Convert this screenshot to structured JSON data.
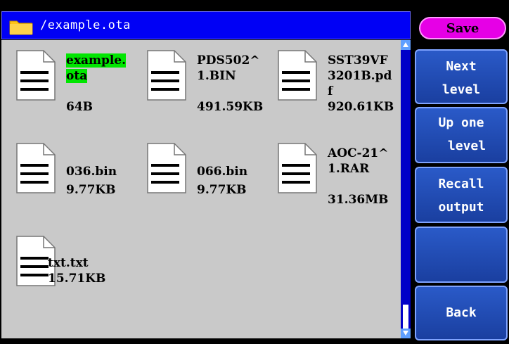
{
  "path": {
    "text": "/example.ota"
  },
  "files": [
    {
      "name_hl": "example.o",
      "name_rest": "ta",
      "highlight": true,
      "size": "64B"
    },
    {
      "name_hl": "",
      "name_rest": "PDS502^1.BIN",
      "highlight": false,
      "size": "491.59KB"
    },
    {
      "name_hl": "",
      "name_rest": "SST39VF3201B.pdf",
      "highlight": false,
      "size": "920.61KB"
    },
    {
      "name_hl": "",
      "name_rest": "036.bin",
      "highlight": false,
      "size": "9.77KB"
    },
    {
      "name_hl": "",
      "name_rest": "066.bin",
      "highlight": false,
      "size": "9.77KB"
    },
    {
      "name_hl": "",
      "name_rest": "AOC-21^1.RAR",
      "highlight": false,
      "size": "31.36MB"
    },
    {
      "name_hl": "",
      "name_rest": "txt.txt",
      "highlight": false,
      "size": "15.71KB"
    }
  ],
  "menu": {
    "save": "Save",
    "next_level_1": "Next",
    "next_level_2": "level",
    "up_one_level_1": "Up one",
    "up_one_level_2": "level",
    "recall_output_1": "Recall",
    "recall_output_2": "output",
    "empty": "",
    "back": "Back"
  },
  "colors": {
    "path_bar": "#0000f5",
    "file_area": "#c9c9c9",
    "highlight": "#00e600",
    "save_button": "#e600e6",
    "menu_button": "#1a3fa0"
  }
}
